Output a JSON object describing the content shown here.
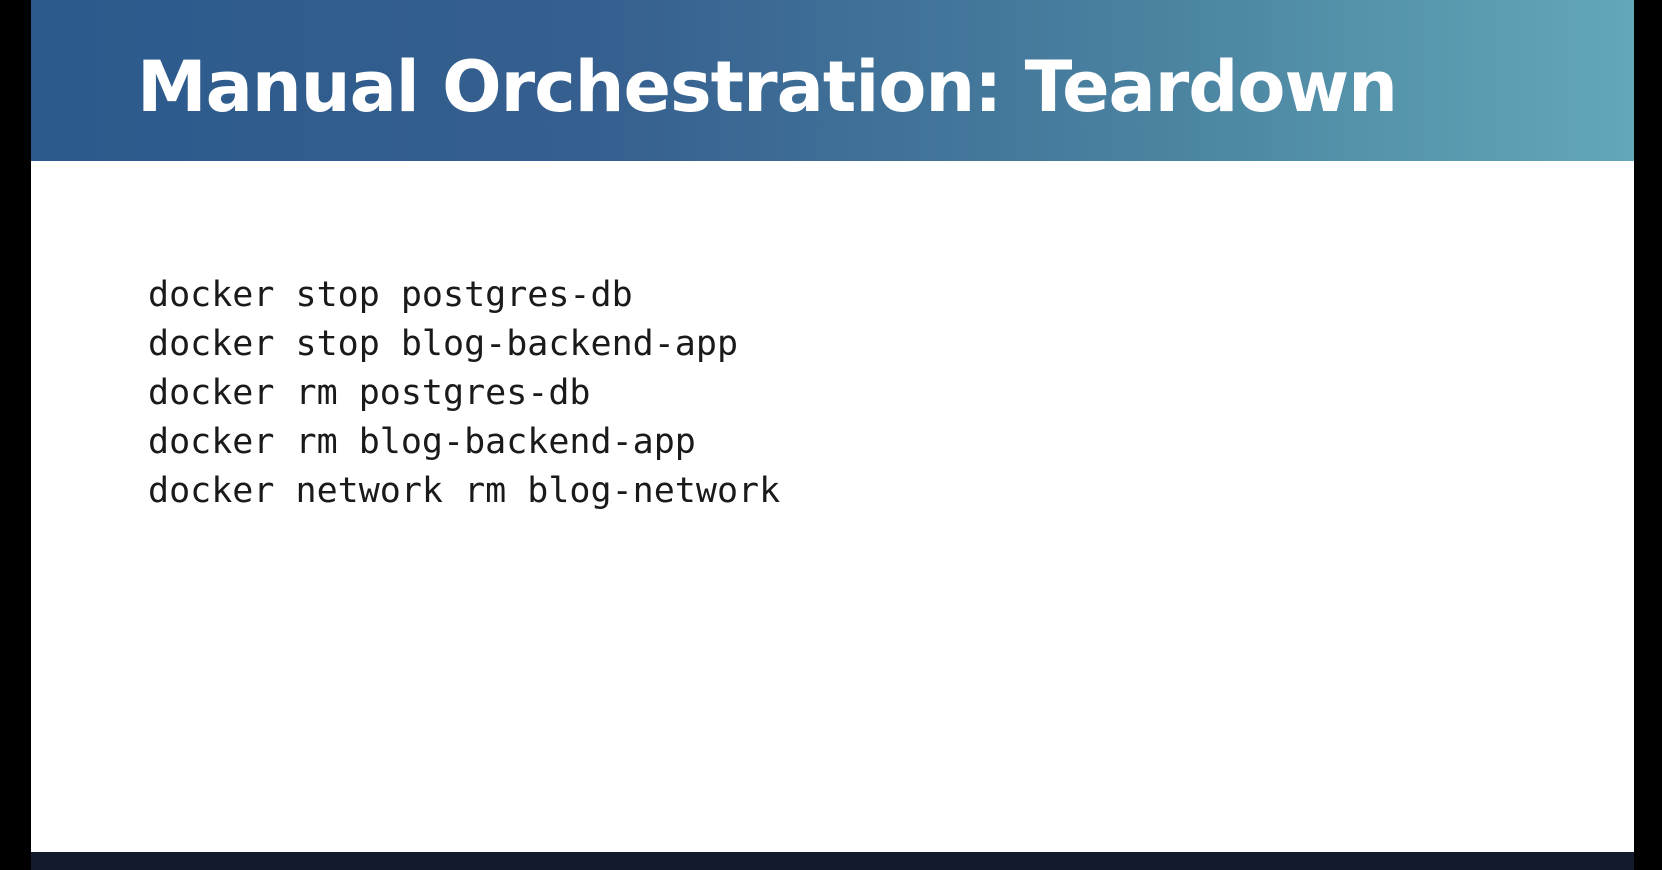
{
  "slide": {
    "title": "Manual Orchestration: Teardown",
    "commands": [
      "docker stop postgres-db",
      "docker stop blog-backend-app",
      "docker rm postgres-db",
      "docker rm blog-backend-app",
      "docker network rm blog-network"
    ]
  },
  "colors": {
    "header_gradient_start": "#2b5a8c",
    "header_gradient_end": "#62a8b8",
    "background": "#ffffff",
    "text": "#1a1a1a",
    "bottom_bar": "#141a2e"
  }
}
